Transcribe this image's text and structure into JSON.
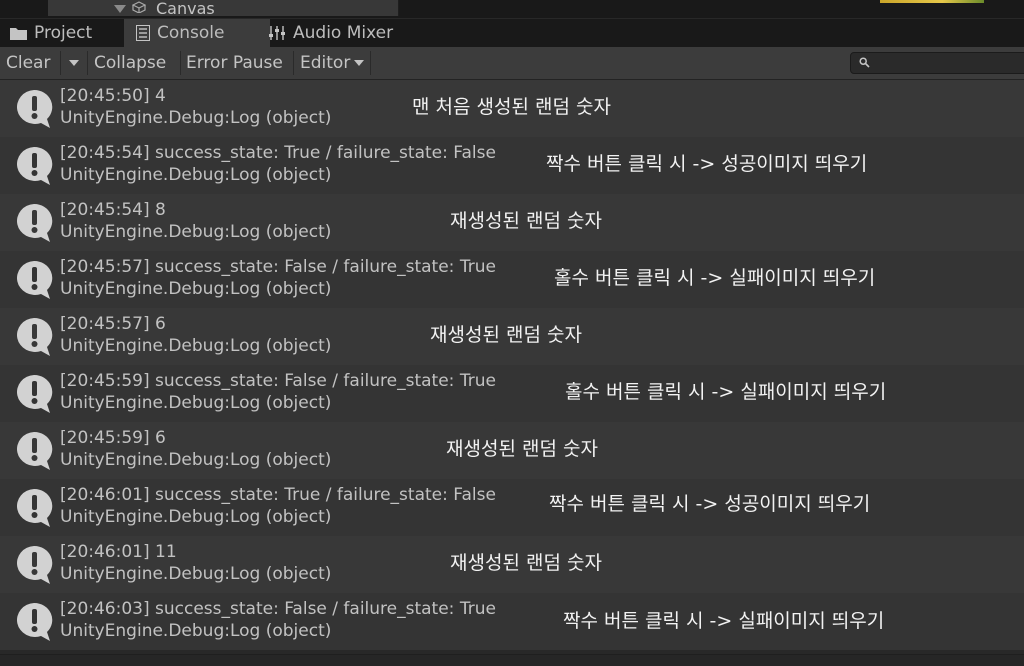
{
  "hierarchy": {
    "item_label": "Canvas"
  },
  "tabs": [
    {
      "label": "Project",
      "icon": "folder-icon"
    },
    {
      "label": "Console",
      "icon": "console-icon",
      "active": true
    },
    {
      "label": "Audio Mixer",
      "icon": "mixer-icon"
    }
  ],
  "toolbar": {
    "clear_label": "Clear",
    "collapse_label": "Collapse",
    "error_pause_label": "Error Pause",
    "editor_label": "Editor",
    "search_value": ""
  },
  "colors": {
    "row_odd": "#383838",
    "row_even": "#343434",
    "warning_icon": "#d2d2d2",
    "panel_bg": "#282828"
  },
  "logs": [
    {
      "message": "[20:45:50] 4",
      "source": "UnityEngine.Debug:Log (object)",
      "note": "맨 처음 생성된 랜덤 숫자"
    },
    {
      "message": "[20:45:54] success_state: True / failure_state: False",
      "source": "UnityEngine.Debug:Log (object)",
      "note": "짝수 버튼 클릭 시 -> 성공이미지 띄우기"
    },
    {
      "message": "[20:45:54] 8",
      "source": "UnityEngine.Debug:Log (object)",
      "note": "재생성된 랜덤 숫자"
    },
    {
      "message": "[20:45:57] success_state: False / failure_state: True",
      "source": "UnityEngine.Debug:Log (object)",
      "note": "홀수 버튼 클릭 시 -> 실패이미지 띄우기"
    },
    {
      "message": "[20:45:57] 6",
      "source": "UnityEngine.Debug:Log (object)",
      "note": "재생성된 랜덤 숫자"
    },
    {
      "message": "[20:45:59] success_state: False / failure_state: True",
      "source": "UnityEngine.Debug:Log (object)",
      "note": "홀수 버튼 클릭 시 -> 실패이미지 띄우기"
    },
    {
      "message": "[20:45:59] 6",
      "source": "UnityEngine.Debug:Log (object)",
      "note": "재생성된 랜덤 숫자"
    },
    {
      "message": "[20:46:01] success_state: True / failure_state: False",
      "source": "UnityEngine.Debug:Log (object)",
      "note": "짝수 버튼 클릭 시 -> 성공이미지 띄우기"
    },
    {
      "message": "[20:46:01] 11",
      "source": "UnityEngine.Debug:Log (object)",
      "note": "재생성된 랜덤 숫자"
    },
    {
      "message": "[20:46:03] success_state: False / failure_state: True",
      "source": "UnityEngine.Debug:Log (object)",
      "note": "짝수 버튼 클릭 시 -> 실패이미지 띄우기"
    }
  ]
}
